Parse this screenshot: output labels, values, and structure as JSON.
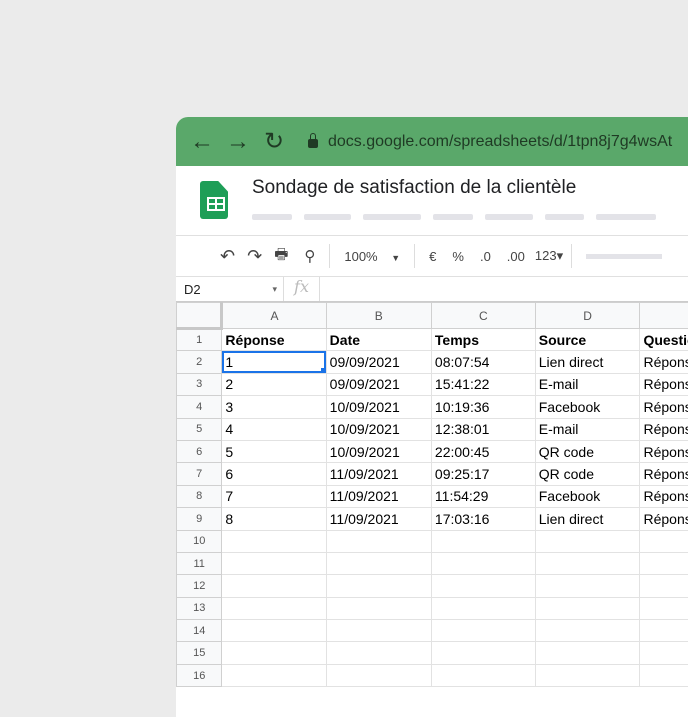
{
  "browser": {
    "url": "docs.google.com/spreadsheets/d/1tpn8j7g4wsAt"
  },
  "document": {
    "title": "Sondage de satisfaction de la clientèle"
  },
  "toolbar": {
    "zoom": "100%",
    "currency": "€",
    "percent": "%",
    "dec_decrease": ".0",
    "dec_increase": ".00",
    "format": "123▾"
  },
  "formula_bar": {
    "cell_ref": "D2",
    "fx": "fx"
  },
  "sheet": {
    "columns": [
      "A",
      "B",
      "C",
      "D",
      ""
    ],
    "rows": [
      [
        "Réponse",
        "Date",
        "Temps",
        "Source",
        "Questions"
      ],
      [
        "1",
        "09/09/2021",
        "08:07:54",
        "Lien direct",
        "Réponse"
      ],
      [
        "2",
        "09/09/2021",
        "15:41:22",
        "E-mail",
        "Réponse"
      ],
      [
        "3",
        "10/09/2021",
        "10:19:36",
        "Facebook",
        "Réponse"
      ],
      [
        "4",
        "10/09/2021",
        "12:38:01",
        "E-mail",
        "Réponse"
      ],
      [
        "5",
        "10/09/2021",
        "22:00:45",
        "QR code",
        "Réponse"
      ],
      [
        "6",
        "11/09/2021",
        "09:25:17",
        "QR code",
        "Réponse"
      ],
      [
        "7",
        "11/09/2021",
        "11:54:29",
        "Facebook",
        "Réponse"
      ],
      [
        "8",
        "11/09/2021",
        "17:03:16",
        "Lien direct",
        "Réponse"
      ],
      [
        "",
        "",
        "",
        "",
        ""
      ],
      [
        "",
        "",
        "",
        "",
        ""
      ],
      [
        "",
        "",
        "",
        "",
        ""
      ],
      [
        "",
        "",
        "",
        "",
        ""
      ],
      [
        "",
        "",
        "",
        "",
        ""
      ],
      [
        "",
        "",
        "",
        "",
        ""
      ],
      [
        "",
        "",
        "",
        "",
        ""
      ]
    ]
  }
}
